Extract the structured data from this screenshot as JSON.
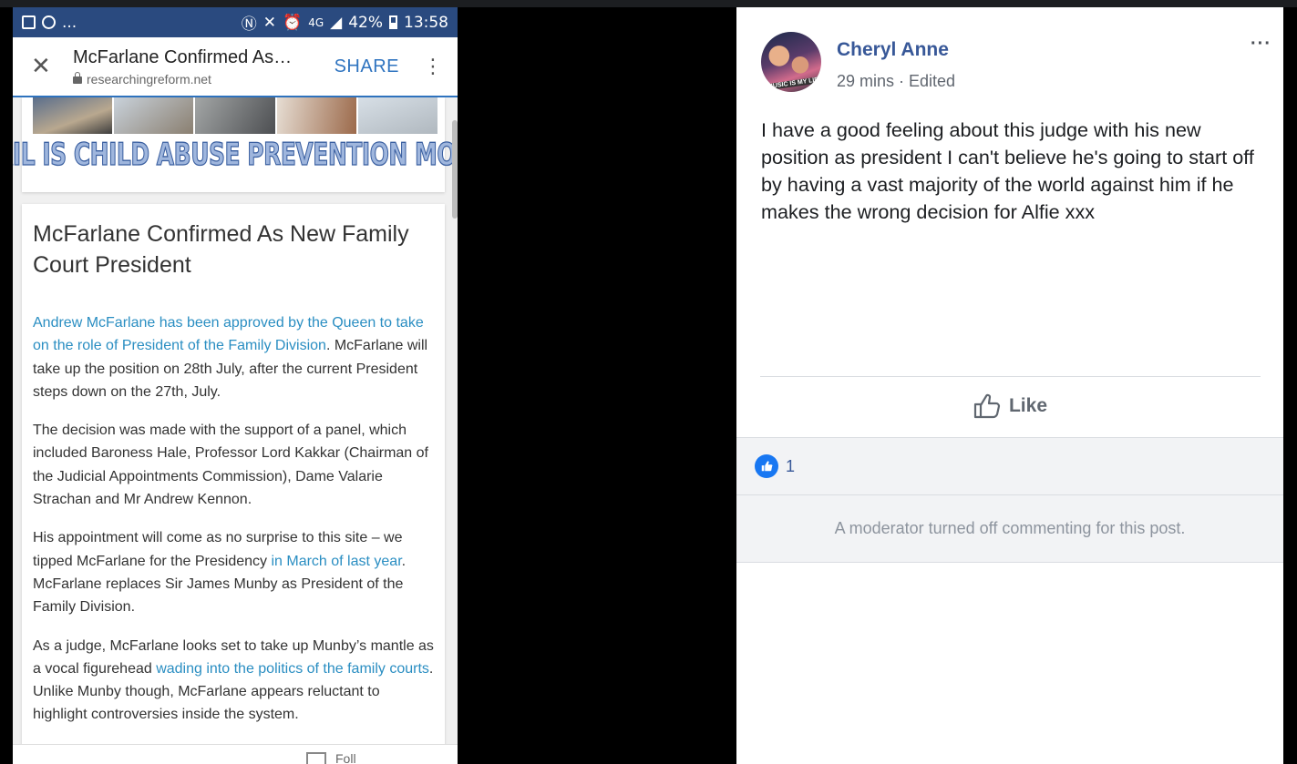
{
  "phone": {
    "status": {
      "dots": "...",
      "battery": "42%",
      "time": "13:58",
      "network": "4G"
    },
    "appbar": {
      "title": "McFarlane Confirmed As…",
      "url": "researchingreform.net",
      "share_label": "SHARE"
    },
    "banner": "APRIL IS CHILD ABUSE PREVENTION MONTH",
    "article": {
      "title": "McFarlane Confirmed As New Family Court President",
      "p1_link": "Andrew McFarlane has been approved by the Queen to take on the role of President of the Family Division",
      "p1_rest": ". McFarlane will take up the position on 28th July, after the current President steps down on the 27th, July.",
      "p2": "The decision was made with the support of a panel, which included Baroness Hale, Professor Lord Kakkar (Chairman of the Judicial Appointments Commission), Dame Valarie Strachan and Mr Andrew Kennon.",
      "p3_a": "His appointment will come as no surprise to this site – we tipped McFarlane for the Presidency ",
      "p3_link": "in March of last year",
      "p3_b": ". McFarlane replaces Sir James Munby as President of the Family Division.",
      "p4_a": "As a judge, McFarlane looks set to take up Munby’s mantle as a vocal figurehead ",
      "p4_link": "wading into the politics of the family courts",
      "p4_b": ". Unlike Munby though, McFarlane appears reluctant to highlight controversies inside the system."
    },
    "bottom_text": "Foll"
  },
  "post": {
    "author": "Cheryl Anne",
    "avatar_tag": "MUSIC IS MY LIFE",
    "meta": "29 mins · Edited",
    "more": "···",
    "text": "I have a good feeling about this judge with his new position as president I can't believe he's going to start off by having a vast majority of the world against him if he makes the wrong decision for Alfie xxx",
    "like_label": "Like",
    "reaction_count": "1",
    "moderator_note": "A moderator turned off commenting for this post."
  },
  "colors": {
    "fb_blue": "#385898",
    "link_blue": "#2a8ec2",
    "share_blue": "#2f74c0",
    "status_bar": "#2a4a7f"
  }
}
